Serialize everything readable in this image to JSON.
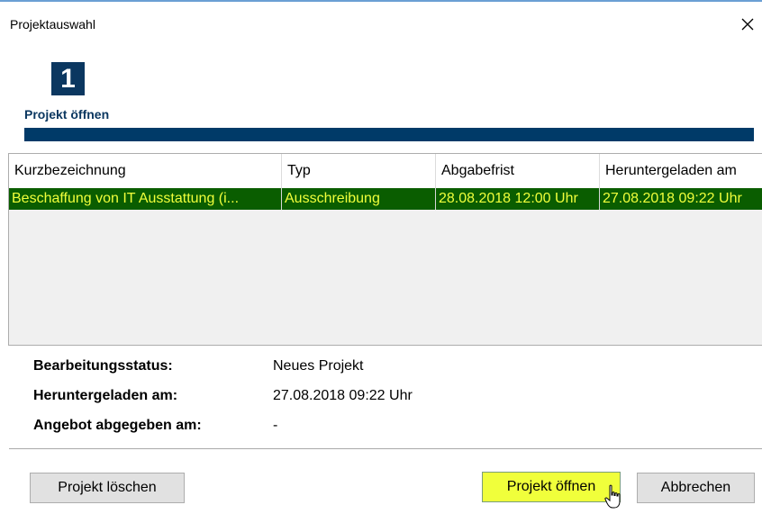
{
  "window": {
    "title": "Projektauswahl",
    "close_icon": "close-icon"
  },
  "wizard": {
    "step_number": "1",
    "step_label": "Projekt öffnen",
    "accent_color": "#003a68"
  },
  "table": {
    "columns": [
      "Kurzbezeichnung",
      "Typ",
      "Abgabefrist",
      "Heruntergeladen am"
    ],
    "rows": [
      {
        "kurzbezeichnung": "Beschaffung von IT Ausstattung (i...",
        "typ": "Ausschreibung",
        "abgabefrist": "28.08.2018 12:00 Uhr",
        "heruntergeladen": "27.08.2018 09:22 Uhr",
        "selected": true
      }
    ],
    "selection_bg": "#0a5d00",
    "selection_fg": "#f0ff3b"
  },
  "status": {
    "bearbeitungsstatus_label": "Bearbeitungsstatus:",
    "bearbeitungsstatus_value": "Neues Projekt",
    "heruntergeladen_label": "Heruntergeladen am:",
    "heruntergeladen_value": "27.08.2018 09:22 Uhr",
    "angebot_label": "Angebot abgegeben am:",
    "angebot_value": "-"
  },
  "buttons": {
    "delete_label": "Projekt löschen",
    "open_label": "Projekt öffnen",
    "cancel_label": "Abbrechen"
  }
}
